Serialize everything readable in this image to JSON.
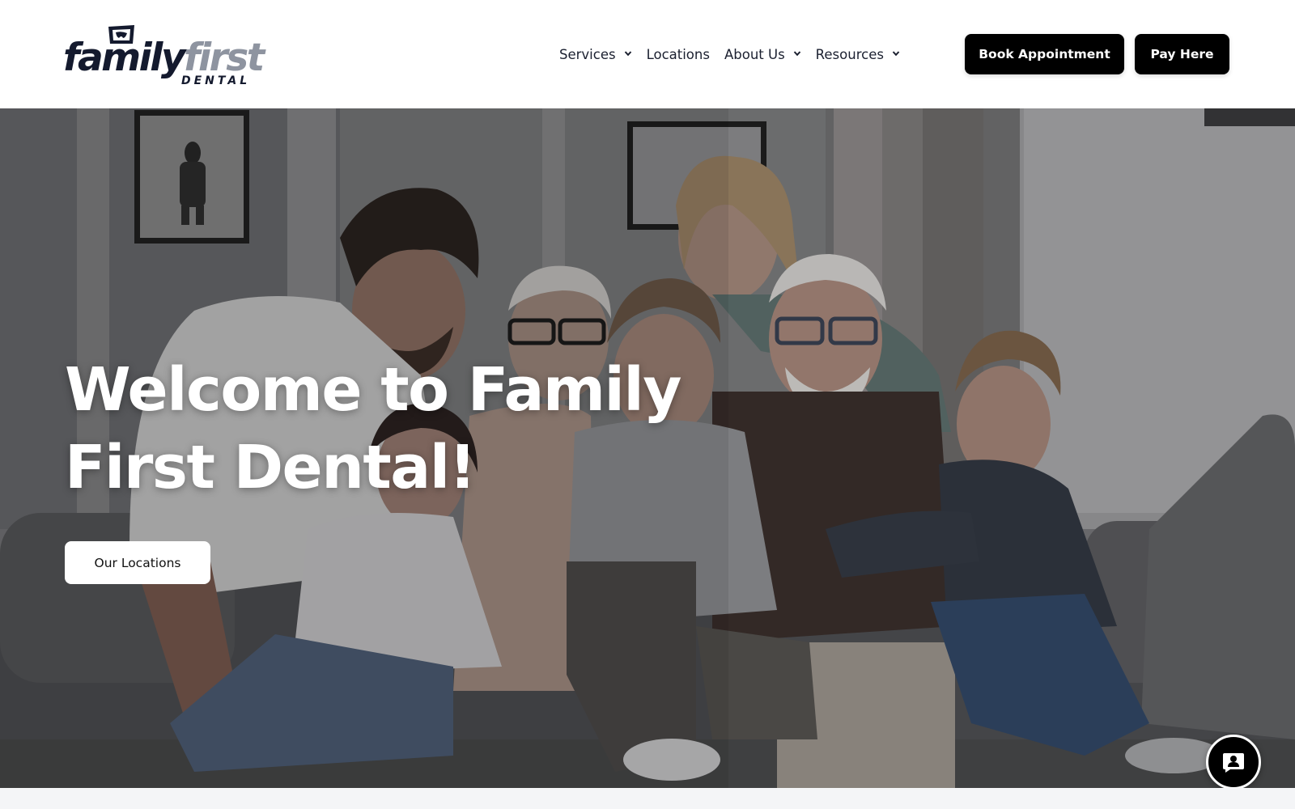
{
  "logo": {
    "word_primary": "family",
    "word_secondary": "first",
    "sub": "DENTAL"
  },
  "nav": {
    "items": [
      {
        "label": "Services",
        "has_dropdown": true
      },
      {
        "label": "Locations",
        "has_dropdown": false
      },
      {
        "label": "About Us",
        "has_dropdown": true
      },
      {
        "label": "Resources",
        "has_dropdown": true
      }
    ]
  },
  "header_buttons": {
    "book": "Book Appointment",
    "pay": "Pay Here"
  },
  "hero": {
    "title_line1": "Welcome to Family",
    "title_line2": "First Dental!",
    "cta": "Our Locations"
  },
  "icons": {
    "dropdown": "chevron-down-icon",
    "chat": "chat-contact-icon"
  },
  "colors": {
    "header_bg": "#ffffff",
    "button_bg": "#000000",
    "button_text": "#ffffff",
    "logo_dark": "#141a2e",
    "logo_gray": "#8e94a0"
  }
}
